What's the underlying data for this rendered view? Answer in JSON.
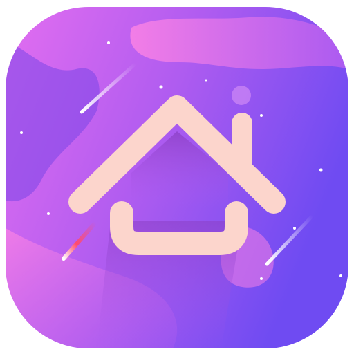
{
  "icon": {
    "name": "home-launcher-app-icon",
    "description_icon_name": "house-icon",
    "colors": {
      "page_background": "#ffffff",
      "tile_gradient_start": "#e36ef0",
      "tile_gradient_mid": "#b05cf0",
      "tile_gradient_end": "#6f4bf2",
      "blob_pink": "#f57fe6",
      "blob_violet": "#7a45e8",
      "house_stroke": "#fcd5cc",
      "house_inner_shadow": "#8b3fc4",
      "shooting_star_white": "#ffffff",
      "shooting_star_red": "#ff4b6e",
      "sparkle": "#ffffff"
    }
  }
}
